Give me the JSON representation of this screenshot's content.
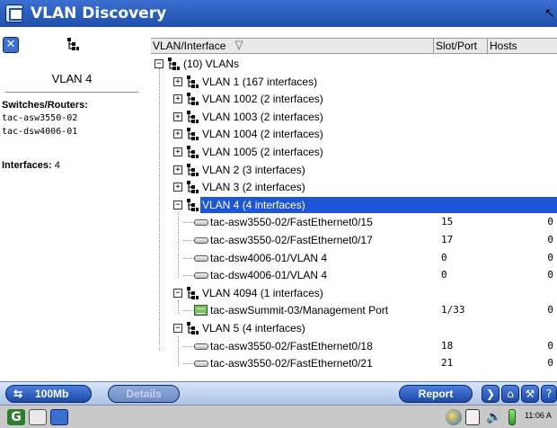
{
  "window": {
    "title": "VLAN Discovery"
  },
  "details": {
    "heading": "VLAN 4",
    "switches_label": "Switches/Routers:",
    "switches": [
      "tac-asw3550-02",
      "tac-dsw4006-01"
    ],
    "interfaces_label": "Interfaces:",
    "interfaces_value": "4"
  },
  "table": {
    "columns": {
      "interface": "VLAN/Interface",
      "slot_port": "Slot/Port",
      "hosts": "Hosts"
    },
    "rows": [
      {
        "level": 0,
        "kind": "root",
        "expander": "minus",
        "label": "(10) VLANs"
      },
      {
        "level": 1,
        "kind": "vlan",
        "expander": "plus",
        "label": "VLAN 1 (167 interfaces)"
      },
      {
        "level": 1,
        "kind": "vlan",
        "expander": "plus",
        "label": "VLAN 1002 (2 interfaces)"
      },
      {
        "level": 1,
        "kind": "vlan",
        "expander": "plus",
        "label": "VLAN 1003 (2 interfaces)"
      },
      {
        "level": 1,
        "kind": "vlan",
        "expander": "plus",
        "label": "VLAN 1004 (2 interfaces)"
      },
      {
        "level": 1,
        "kind": "vlan",
        "expander": "plus",
        "label": "VLAN 1005 (2 interfaces)"
      },
      {
        "level": 1,
        "kind": "vlan",
        "expander": "plus",
        "label": "VLAN 2 (3 interfaces)"
      },
      {
        "level": 1,
        "kind": "vlan",
        "expander": "plus",
        "label": "VLAN 3 (2 interfaces)"
      },
      {
        "level": 1,
        "kind": "vlan",
        "expander": "minus",
        "label": "VLAN 4 (4 interfaces)",
        "selected": true
      },
      {
        "level": 2,
        "kind": "port",
        "label": "tac-asw3550-02/FastEthernet0/15",
        "slot": "15",
        "hosts": "0"
      },
      {
        "level": 2,
        "kind": "port",
        "label": "tac-asw3550-02/FastEthernet0/17",
        "slot": "17",
        "hosts": "0"
      },
      {
        "level": 2,
        "kind": "port",
        "label": "tac-dsw4006-01/VLAN 4",
        "slot": "0",
        "hosts": "0"
      },
      {
        "level": 2,
        "kind": "port",
        "label": "tac-dsw4006-01/VLAN 4",
        "slot": "0",
        "hosts": "0"
      },
      {
        "level": 1,
        "kind": "vlan",
        "expander": "minus",
        "label": "VLAN 4094 (1 interfaces)"
      },
      {
        "level": 2,
        "kind": "mgmt",
        "label": "tac-aswSummit-03/Management Port",
        "slot": "1/33",
        "hosts": "0"
      },
      {
        "level": 1,
        "kind": "vlan",
        "expander": "minus",
        "label": "VLAN 5 (4 interfaces)"
      },
      {
        "level": 2,
        "kind": "port",
        "label": "tac-asw3550-02/FastEthernet0/18",
        "slot": "18",
        "hosts": "0"
      },
      {
        "level": 2,
        "kind": "port",
        "label": "tac-asw3550-02/FastEthernet0/21",
        "slot": "21",
        "hosts": "0"
      }
    ]
  },
  "toolbar": {
    "speed_label": "100Mb",
    "details_label": "Details",
    "report_label": "Report",
    "icons": [
      "forward-icon",
      "home-icon",
      "tools-icon",
      "help-icon"
    ]
  },
  "taskbar": {
    "time": "11:06 A",
    "icons": [
      "start-icon",
      "keyboard-icon",
      "window-icon",
      "world-icon",
      "clipboard-icon",
      "speaker-icon",
      "battery-icon"
    ]
  },
  "colors": {
    "title_bar": "#1f4fa8",
    "selection": "#1e55d8",
    "toolbar_button": "#2a5cc0"
  }
}
